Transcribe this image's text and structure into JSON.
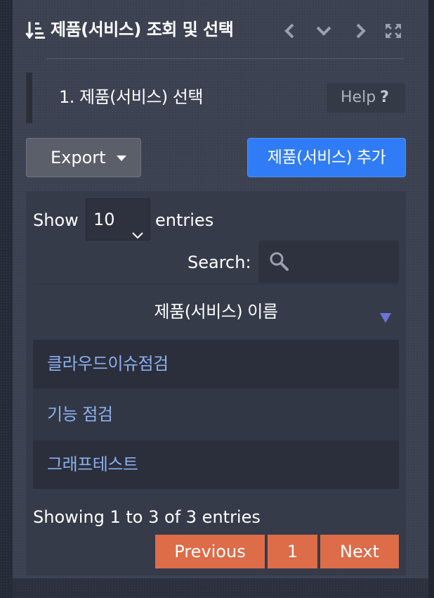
{
  "header": {
    "title": "제품(서비스) 조회 및 선택",
    "icons": [
      "sort-list-icon",
      "chevron-left-icon",
      "chevron-down-icon",
      "chevron-right-icon",
      "fullscreen-icon"
    ]
  },
  "section": {
    "title": "1. 제품(서비스) 선택",
    "help_label": "Help",
    "help_icon": "?"
  },
  "toolbar": {
    "export_label": "Export",
    "add_label": "제품(서비스) 추가"
  },
  "table": {
    "show_label": "Show",
    "length_value": "10",
    "entries_label": "entries",
    "search_label": "Search:",
    "search_value": "",
    "column_header": "제품(서비스) 이름",
    "rows": [
      "클라우드이슈점검",
      "기능 점검",
      "그래프테스트"
    ],
    "info": "Showing 1 to 3 of 3 entries"
  },
  "pagination": {
    "previous": "Previous",
    "current_page": "1",
    "next": "Next"
  },
  "colors": {
    "panel": "#3b4150",
    "primary_button": "#2f7cf6",
    "pagination_button": "#dd6c49",
    "link_text": "#8cb0ef",
    "sort_indicator": "#6d73d6"
  }
}
